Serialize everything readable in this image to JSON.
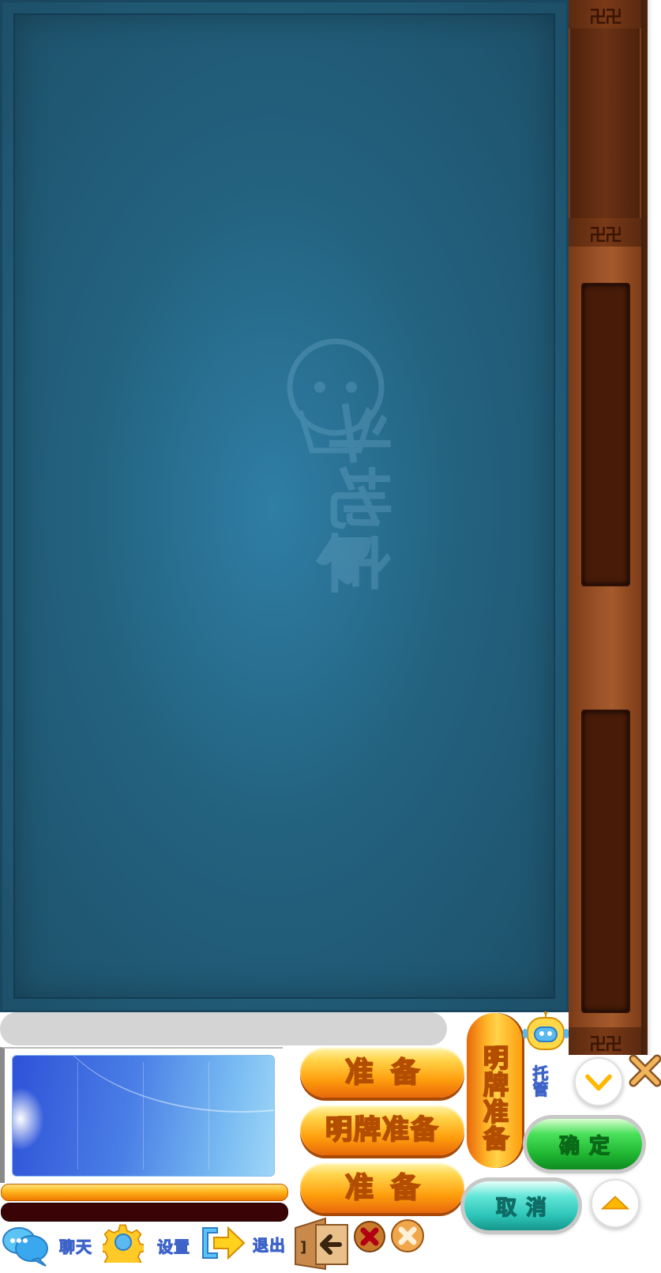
{
  "table": {
    "watermark_text": "斗地主"
  },
  "bottom": {
    "chat_label": "聊天",
    "settings_label": "设置",
    "exit_label": "退出"
  },
  "buttons": {
    "ready_1": "准备",
    "ready_show_cards": "明牌准备",
    "ready_2": "准备",
    "vertical_ready_show": "明牌准备",
    "auto_play": "托管",
    "confirm": "确定",
    "cancel": "取消"
  },
  "icons": {
    "chat": "chat-bubbles-icon",
    "settings": "gear-icon",
    "exit": "exit-arrow-icon",
    "door": "door-exit-icon",
    "robot": "robot-icon",
    "dropdown": "chevron-down-icon",
    "collapse": "triangle-up-icon",
    "close": "close-x-icon",
    "remove": "red-x-icon"
  },
  "colors": {
    "felt": "#23627f",
    "wood": "#9a5228",
    "orange_button": "#ff9e0d",
    "green_button": "#1fb632",
    "teal_button": "#2cc5b8",
    "label_blue": "#8ea6e8"
  }
}
